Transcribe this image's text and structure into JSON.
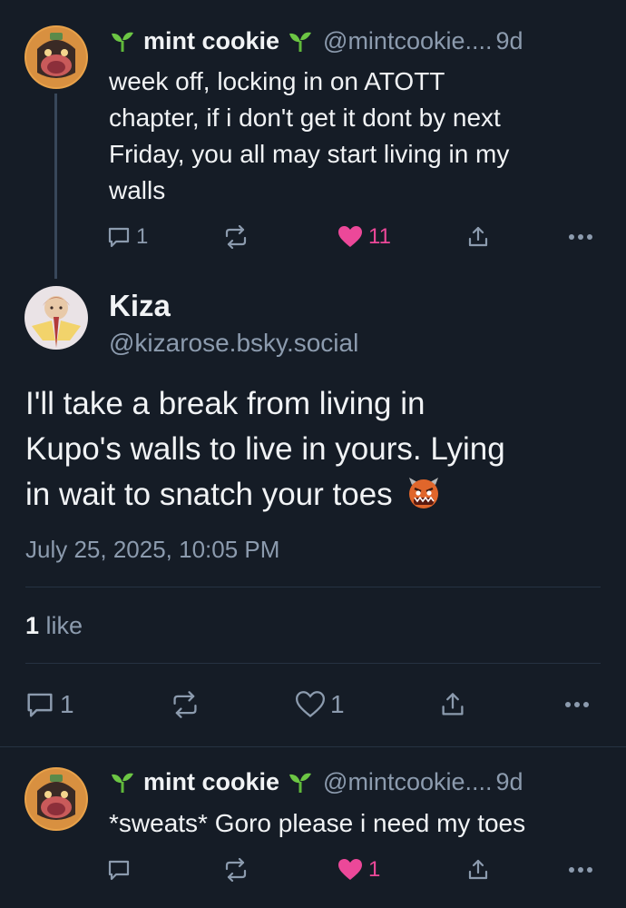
{
  "posts": [
    {
      "author": "mint cookie",
      "handle": "@mintcookie....",
      "time": "9d",
      "text_lines": [
        "week off, locking in on ATOTT",
        "chapter, if i don't get it dont by next",
        "Friday, you all may start living in my",
        "walls"
      ],
      "replies": "1",
      "reposts": "",
      "likes": "11",
      "liked": true
    },
    {
      "author": "mint cookie",
      "handle": "@mintcookie....",
      "time": "9d",
      "text_lines": [
        "*sweats* Goro please i need my toes"
      ],
      "replies": "",
      "reposts": "",
      "likes": "1",
      "liked": true
    }
  ],
  "main": {
    "author": "Kiza",
    "handle": "@kizarose.bsky.social",
    "text_lines": [
      "I'll take a break from living in",
      "Kupo's walls to live in yours. Lying",
      "in wait to snatch your toes"
    ],
    "emoji": "ogre-emoji",
    "date": "July 25, 2025, 10:05 PM",
    "likes_count": "1",
    "likes_word": "like",
    "replies": "1",
    "reposts": "",
    "likes": "1"
  },
  "icons": {
    "sprout": "sprout-emoji",
    "reply": "reply-icon",
    "repost": "repost-icon",
    "like": "heart-icon",
    "share": "share-icon",
    "more": "more-icon"
  },
  "colors": {
    "background": "#151c26",
    "text": "#f1f3f5",
    "muted": "#8c9bae",
    "like": "#ec4899",
    "divider": "#263242",
    "thread_line": "#38475a"
  }
}
